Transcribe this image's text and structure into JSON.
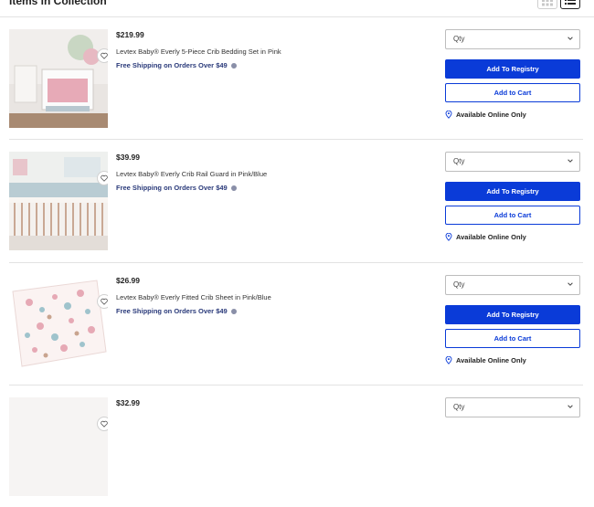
{
  "header": {
    "title": "Items in Collection",
    "grid_view_icon": "grid-icon",
    "list_view_icon": "list-icon"
  },
  "items": [
    {
      "price": "$219.99",
      "name": "Levtex Baby® Everly 5-Piece Crib Bedding Set in Pink",
      "shipping": "Free Shipping on Orders Over $49",
      "qty_placeholder": "Qty",
      "registry_label": "Add To Registry",
      "cart_label": "Add to Cart",
      "availability": "Available Online Only"
    },
    {
      "price": "$39.99",
      "name": "Levtex Baby® Everly Crib Rail Guard in Pink/Blue",
      "shipping": "Free Shipping on Orders Over $49",
      "qty_placeholder": "Qty",
      "registry_label": "Add To Registry",
      "cart_label": "Add to Cart",
      "availability": "Available Online Only"
    },
    {
      "price": "$26.99",
      "name": "Levtex Baby® Everly Fitted Crib Sheet in Pink/Blue",
      "shipping": "Free Shipping on Orders Over $49",
      "qty_placeholder": "Qty",
      "registry_label": "Add To Registry",
      "cart_label": "Add to Cart",
      "availability": "Available Online Only"
    },
    {
      "price": "$32.99",
      "qty_placeholder": "Qty"
    }
  ],
  "colors": {
    "primary": "#0a3bd8",
    "shipping_text": "#2a3a7a",
    "divider": "#e3e3e3"
  }
}
